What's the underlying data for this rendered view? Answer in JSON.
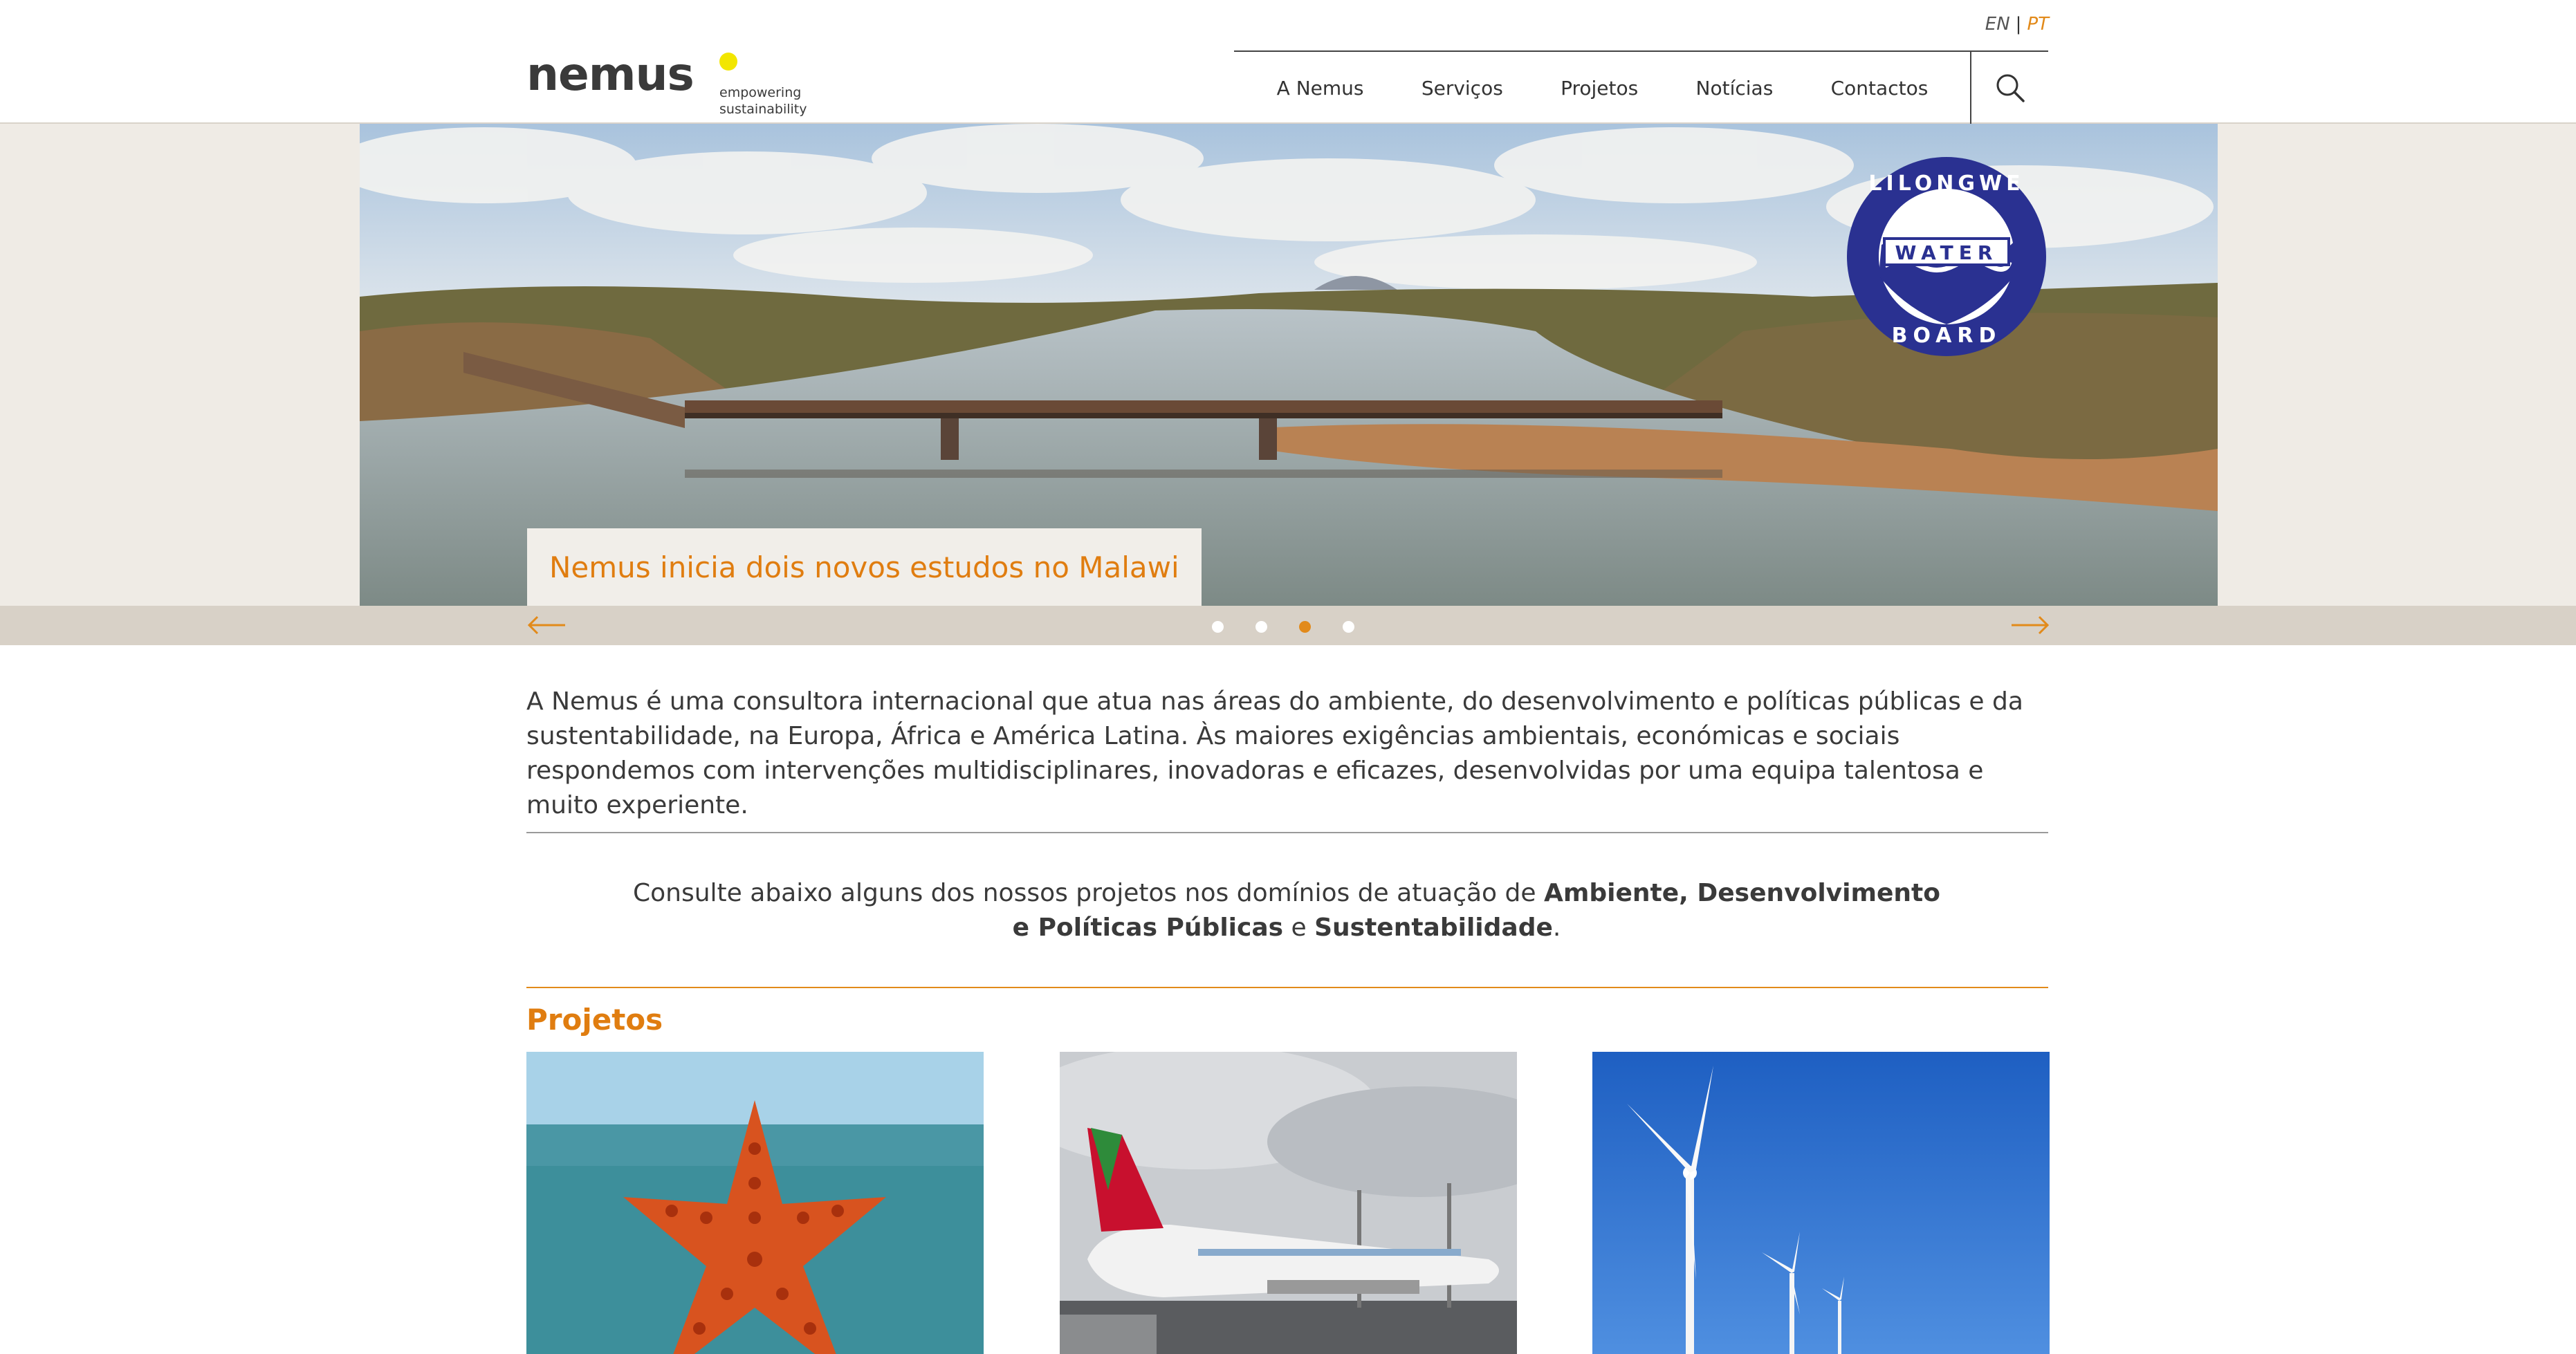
{
  "brand": {
    "name": "nemus",
    "tagline_line1": "empowering",
    "tagline_line2": "sustainability",
    "accent_color": "#e28a1a",
    "dot_color": "#f2e600"
  },
  "language": {
    "en": "EN",
    "separator": "|",
    "pt": "PT",
    "active": "PT"
  },
  "nav": {
    "items": [
      {
        "label": "A Nemus"
      },
      {
        "label": "Serviços"
      },
      {
        "label": "Projetos"
      },
      {
        "label": "Notícias"
      },
      {
        "label": "Contactos"
      }
    ],
    "search_icon": "search-icon"
  },
  "hero": {
    "caption": "Nemus inicia dois novos estudos no Malawi",
    "logo_text_top": "LILONGWE",
    "logo_text_middle": "WATER",
    "logo_text_bottom": "BOARD",
    "slides_total": 4,
    "active_slide": 3,
    "prev_icon": "arrow-left-icon",
    "next_icon": "arrow-right-icon"
  },
  "intro": {
    "text": "A Nemus é uma consultora internacional que atua nas áreas do ambiente, do desenvolvimento e políticas públicas e da sustentabilidade, na Europa, África e América Latina. Às maiores exigências ambientais, económicas e sociais respondemos com intervenções multidisciplinares, inovadoras e eficazes, desenvolvidas por uma equipa talentosa e muito experiente."
  },
  "domains": {
    "prefix": "Consulte abaixo alguns dos nossos projetos nos domínios de atuação de ",
    "d1": "Ambiente",
    "comma": ", ",
    "d2": "Desenvolvimento e Políticas Públicas",
    "and": " e ",
    "d3": "Sustentabilidade",
    "end": "."
  },
  "projects": {
    "title": "Projetos"
  }
}
